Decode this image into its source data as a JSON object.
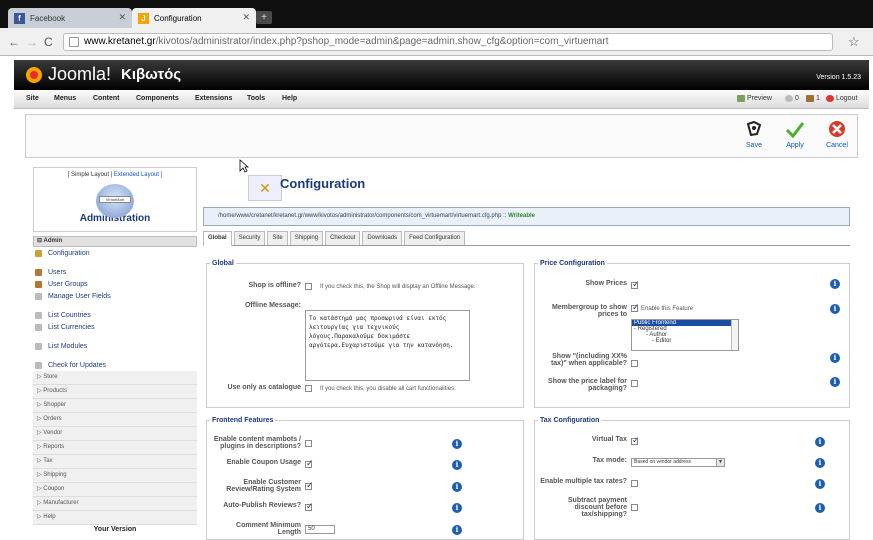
{
  "browser": {
    "tabs": [
      {
        "label": "Facebook"
      },
      {
        "label": "Configuration"
      }
    ],
    "url_host": "www.kretanet.gr",
    "url_path": "/kivotos/administrator/index.php?pshop_mode=admin&page=admin.show_cfg&option=com_virtuemart"
  },
  "header": {
    "brand": "Joomla!",
    "site_name": "Κιβωτός",
    "version": "Version 1.5.23"
  },
  "menu": {
    "items": [
      "Site",
      "Menus",
      "Content",
      "Components",
      "Extensions",
      "Tools",
      "Help"
    ],
    "preview": "Preview",
    "messages": "0",
    "users": "1",
    "logout": "Logout"
  },
  "toolbar": {
    "save": "Save",
    "apply": "Apply",
    "cancel": "Cancel"
  },
  "sidebar": {
    "layout_simple": "[ Simple Layout |",
    "layout_extended": " Extended Layout ]",
    "logo_text": "VirtueMart",
    "title": "Administration",
    "section_admin": "Admin",
    "items": [
      "Configuration",
      "Users",
      "User Groups",
      "Manage User Fields",
      "List Countries",
      "List Currencies",
      "List Modules",
      "Check for Updates"
    ],
    "sections": [
      "Store",
      "Products",
      "Shopper",
      "Orders",
      "Vendor",
      "Reports",
      "Tax",
      "Shipping",
      "Coupon",
      "Manufacturer",
      "Help"
    ],
    "your_version": "Your Version"
  },
  "page": {
    "title": "Configuration",
    "path": "/home/www/cretanet/kretanet.gr/www/kivotos/administrator/components/com_virtuemart/virtuemart.cfg.php :: ",
    "writeable": "Writeable",
    "tabs": [
      "Global",
      "Security",
      "Site",
      "Shipping",
      "Checkout",
      "Downloads",
      "Feed Configuration"
    ]
  },
  "global": {
    "legend": "Global",
    "shop_offline_label": "Shop is offline?",
    "shop_offline_hint": "If you check this, the Shop will display an Offline Message.",
    "offline_message_label": "Offline Message:",
    "offline_message": "Το κατάστημά μας προσωρινά είναι εκτός λειτουργίας για τεχνικούς λόγους.Παρακαλούμε δοκιμάστε αργότερα.Ευχαριστούμε για την κατανόηση.",
    "catalogue_label": "Use only as catalogue",
    "catalogue_hint": "If you check this, you disable all cart functionalities."
  },
  "price": {
    "legend": "Price Configuration",
    "show_prices": "Show Prices",
    "membergroup": "Membergroup to show prices to",
    "enable_feature": "Enable this Feature",
    "groups": [
      "Public Frontend",
      "- Registered",
      "- Author",
      "- Editor"
    ],
    "including_tax": "Show \"(including XX% tax)\" when applicable?",
    "packaging": "Show the price label for packaging?"
  },
  "frontend": {
    "legend": "Frontend Features",
    "mambots": "Enable content mambots / plugins in descriptions?",
    "coupon": "Enable Coupon Usage",
    "reviews": "Enable Customer Review/Rating System",
    "autopublish": "Auto-Publish Reviews?",
    "comment_min": "Comment Minimum Length",
    "comment_min_value": "50"
  },
  "tax": {
    "legend": "Tax Configuration",
    "virtual": "Virtual Tax",
    "mode": "Tax mode:",
    "mode_value": "Based on vendor address",
    "multiple": "Enable multiple tax rates?",
    "subtract": "Subtract payment discount before tax/shipping?"
  }
}
